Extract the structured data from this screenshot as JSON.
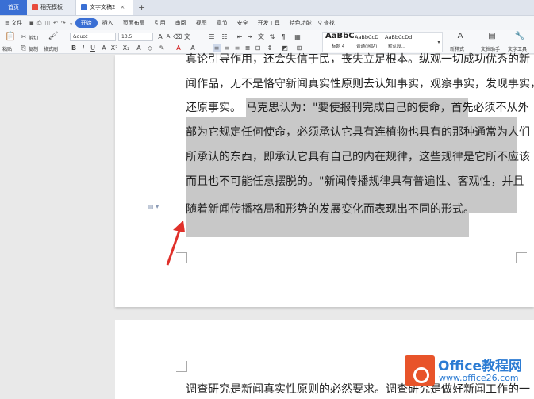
{
  "tabs": {
    "home": "首页",
    "t2": "稻壳模板",
    "t3": "文字文稿2",
    "plus": "+"
  },
  "menu": {
    "file": "≡ 文件",
    "start": "开始",
    "insert": "插入",
    "layout": "页面布局",
    "reference": "引用",
    "review": "审阅",
    "view": "视图",
    "chapter": "章节",
    "security": "安全",
    "devtools": "开发工具",
    "special": "特色功能",
    "search": "查找"
  },
  "ribbon": {
    "paste": "粘贴",
    "cut": "剪切",
    "copy": "复制",
    "format_painter": "格式刷",
    "font_name": "&quot",
    "font_size": "13.5",
    "styles": [
      {
        "sample": "AaBbC",
        "name": "标题 4"
      },
      {
        "sample": "AaBbCcD",
        "name": "普通(网站)"
      },
      {
        "sample": "AaBbCcDd",
        "name": "默认段..."
      }
    ],
    "new_style": "新样式",
    "writing_assistant": "文档助手",
    "text_tools": "文字工具"
  },
  "document": {
    "lines": [
      "真论引导作用，还会失信于民，丧失立足根本。纵观一切成功优秀的新",
      "闻作品，无不是恪守新闻真实性原则去认知事实，观察事实，发现事实，",
      "还原事实。",
      "马克思认为：\"要使报刊完成自己的使命，首先必须不从外",
      "部为它规定任何使命，必须承认它具有连植物也具有的那种通常为人们",
      "所承认的东西，即承认它具有自己的内在规律，这些规律是它所不应该",
      "而且也不可能任意摆脱的。\"新闻传播规律具有普遍性、客观性，并且",
      "随着新闻传播格局和形势的发展变化而表现出不同的形式。"
    ],
    "page2_line": "调查研究是新闻真实性原则的必然要求。调查研究是做好新闻工作的一"
  },
  "watermark": {
    "title": "Office教程网",
    "url": "www.office26.com"
  },
  "colors": {
    "accent": "#3a6fd4",
    "highlight": "#c8c8c8",
    "arrow": "#e0302a"
  }
}
